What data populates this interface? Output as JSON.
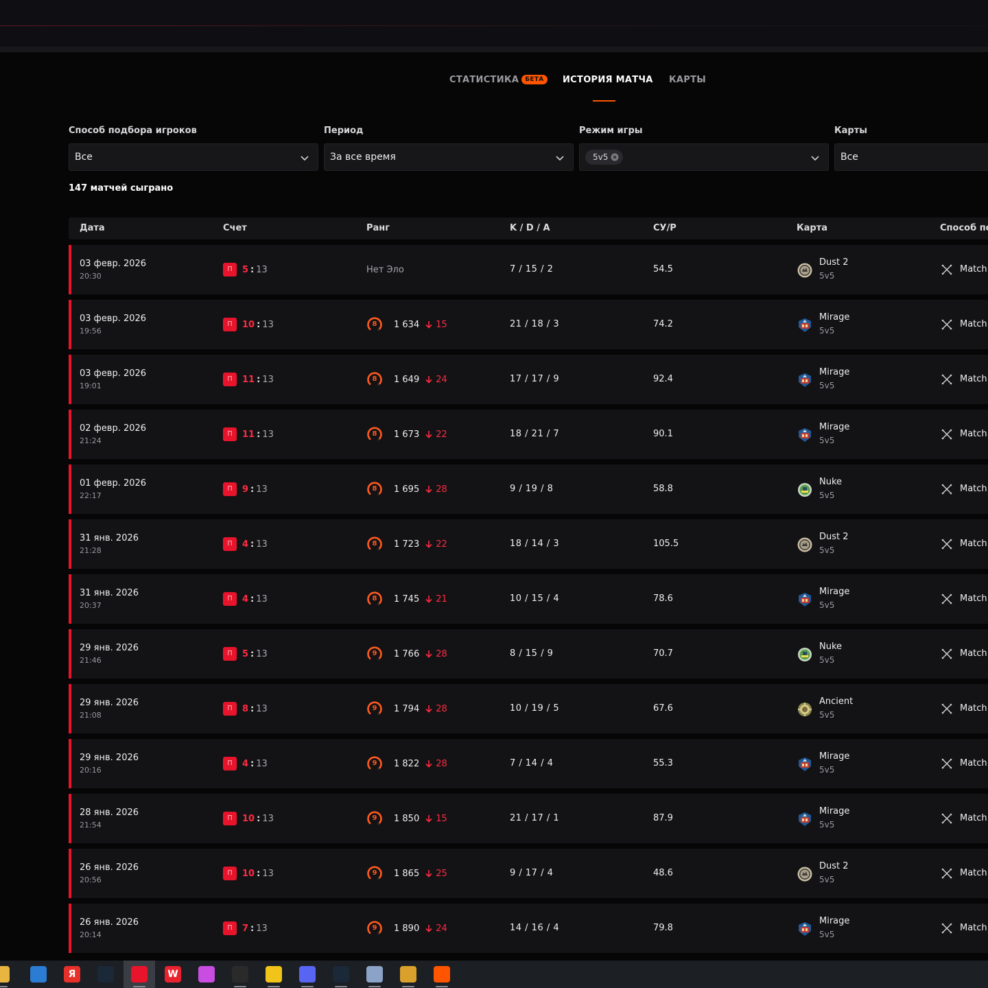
{
  "tabs": [
    {
      "label": "СТАТИСТИКА",
      "badge": "БЕТА"
    },
    {
      "label": "ИСТОРИЯ МАТЧА"
    },
    {
      "label": "КАРТЫ"
    }
  ],
  "active_tab": "ИСТОРИЯ МАТЧА",
  "accent_color": "#ff5500",
  "loss_color": "#e8142b",
  "filters": {
    "matchmaking": {
      "label": "Способ подбора игроков",
      "value": "Все"
    },
    "period": {
      "label": "Период",
      "value": "За все время"
    },
    "mode": {
      "label": "Режим игры",
      "chip": "5v5"
    },
    "maps": {
      "label": "Карты",
      "value": "Все"
    }
  },
  "match_count": "147 матчей сыграно",
  "columns": [
    "Дата",
    "Счет",
    "Ранг",
    "K / D / A",
    "СУ/Р",
    "Карта",
    "Способ под"
  ],
  "matches": [
    {
      "date": "03 февр. 2026",
      "time": "20:30",
      "result": "П",
      "own": "5",
      "sep": ":",
      "opp": "13",
      "rank_text": "Нет Эло",
      "kda": "7 / 15 / 2",
      "adr": "54.5",
      "map": "Dust 2",
      "map_icon": "dust2-icon",
      "mode": "5v5",
      "mm": "Match"
    },
    {
      "date": "03 февр. 2026",
      "time": "19:56",
      "result": "П",
      "own": "10",
      "sep": ":",
      "opp": "13",
      "level": "8",
      "elo": "1 634",
      "delta": "15",
      "kda": "21 / 18 / 3",
      "adr": "74.2",
      "map": "Mirage",
      "map_icon": "mirage-icon",
      "mode": "5v5",
      "mm": "Match"
    },
    {
      "date": "03 февр. 2026",
      "time": "19:01",
      "result": "П",
      "own": "11",
      "sep": ":",
      "opp": "13",
      "level": "8",
      "elo": "1 649",
      "delta": "24",
      "kda": "17 / 17 / 9",
      "adr": "92.4",
      "map": "Mirage",
      "map_icon": "mirage-icon",
      "mode": "5v5",
      "mm": "Match"
    },
    {
      "date": "02 февр. 2026",
      "time": "21:24",
      "result": "П",
      "own": "11",
      "sep": ":",
      "opp": "13",
      "level": "8",
      "elo": "1 673",
      "delta": "22",
      "kda": "18 / 21 / 7",
      "adr": "90.1",
      "map": "Mirage",
      "map_icon": "mirage-icon",
      "mode": "5v5",
      "mm": "Match"
    },
    {
      "date": "01 февр. 2026",
      "time": "22:17",
      "result": "П",
      "own": "9",
      "sep": ":",
      "opp": "13",
      "level": "8",
      "elo": "1 695",
      "delta": "28",
      "kda": "9 / 19 / 8",
      "adr": "58.8",
      "map": "Nuke",
      "map_icon": "nuke-icon",
      "mode": "5v5",
      "mm": "Match"
    },
    {
      "date": "31 янв. 2026",
      "time": "21:28",
      "result": "П",
      "own": "4",
      "sep": ":",
      "opp": "13",
      "level": "8",
      "elo": "1 723",
      "delta": "22",
      "kda": "18 / 14 / 3",
      "adr": "105.5",
      "map": "Dust 2",
      "map_icon": "dust2-icon",
      "mode": "5v5",
      "mm": "Match"
    },
    {
      "date": "31 янв. 2026",
      "time": "20:37",
      "result": "П",
      "own": "4",
      "sep": ":",
      "opp": "13",
      "level": "8",
      "elo": "1 745",
      "delta": "21",
      "kda": "10 / 15 / 4",
      "adr": "78.6",
      "map": "Mirage",
      "map_icon": "mirage-icon",
      "mode": "5v5",
      "mm": "Match"
    },
    {
      "date": "29 янв. 2026",
      "time": "21:46",
      "result": "П",
      "own": "5",
      "sep": ":",
      "opp": "13",
      "level": "9",
      "elo": "1 766",
      "delta": "28",
      "kda": "8 / 15 / 9",
      "adr": "70.7",
      "map": "Nuke",
      "map_icon": "nuke-icon",
      "mode": "5v5",
      "mm": "Match"
    },
    {
      "date": "29 янв. 2026",
      "time": "21:08",
      "result": "П",
      "own": "8",
      "sep": ":",
      "opp": "13",
      "level": "9",
      "elo": "1 794",
      "delta": "28",
      "kda": "10 / 19 / 5",
      "adr": "67.6",
      "map": "Ancient",
      "map_icon": "ancient-icon",
      "mode": "5v5",
      "mm": "Match"
    },
    {
      "date": "29 янв. 2026",
      "time": "20:16",
      "result": "П",
      "own": "4",
      "sep": ":",
      "opp": "13",
      "level": "9",
      "elo": "1 822",
      "delta": "28",
      "kda": "7 / 14 / 4",
      "adr": "55.3",
      "map": "Mirage",
      "map_icon": "mirage-icon",
      "mode": "5v5",
      "mm": "Match"
    },
    {
      "date": "28 янв. 2026",
      "time": "21:54",
      "result": "П",
      "own": "10",
      "sep": ":",
      "opp": "13",
      "level": "9",
      "elo": "1 850",
      "delta": "15",
      "kda": "21 / 17 / 1",
      "adr": "87.9",
      "map": "Mirage",
      "map_icon": "mirage-icon",
      "mode": "5v5",
      "mm": "Match"
    },
    {
      "date": "26 янв. 2026",
      "time": "20:56",
      "result": "П",
      "own": "10",
      "sep": ":",
      "opp": "13",
      "level": "9",
      "elo": "1 865",
      "delta": "25",
      "kda": "9 / 17 / 4",
      "adr": "48.6",
      "map": "Dust 2",
      "map_icon": "dust2-icon",
      "mode": "5v5",
      "mm": "Match"
    },
    {
      "date": "26 янв. 2026",
      "time": "20:14",
      "result": "П",
      "own": "7",
      "sep": ":",
      "opp": "13",
      "level": "9",
      "elo": "1 890",
      "delta": "24",
      "kda": "14 / 16 / 4",
      "adr": "79.8",
      "map": "Mirage",
      "map_icon": "mirage-icon",
      "mode": "5v5",
      "mm": "Match"
    }
  ],
  "taskbar": [
    {
      "icon": "file-explorer-icon",
      "color": "#e8b640"
    },
    {
      "icon": "outlook-icon",
      "color": "#2b7cd3"
    },
    {
      "icon": "yandex-browser-icon",
      "color": "#e8302a",
      "glyph": "Я"
    },
    {
      "icon": "steam-icon",
      "color": "#1b2838"
    },
    {
      "icon": "opera-gx-icon",
      "color": "#e8142b"
    },
    {
      "icon": "wps-office-icon",
      "color": "#e8232f",
      "glyph": "W"
    },
    {
      "icon": "color-picker-icon",
      "color": "#c94de0"
    },
    {
      "icon": "terminal-icon",
      "color": "#2a2a2a"
    },
    {
      "icon": "vpn-lock-icon",
      "color": "#f0c419"
    },
    {
      "icon": "discord-icon",
      "color": "#5865f2"
    },
    {
      "icon": "steam-icon",
      "color": "#1b2838"
    },
    {
      "icon": "network-app-icon",
      "color": "#8ba3c7"
    },
    {
      "icon": "counter-strike-icon",
      "color": "#d9a12b"
    },
    {
      "icon": "faceit-anticheat-icon",
      "color": "#ff5500"
    }
  ]
}
